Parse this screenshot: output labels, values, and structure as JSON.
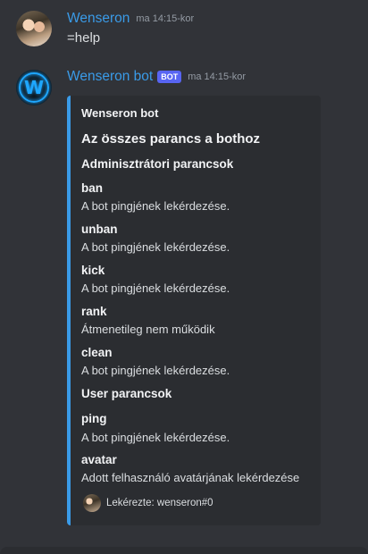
{
  "message1": {
    "username": "Wenseron",
    "timestamp": "ma 14:15-kor",
    "content": "=help"
  },
  "message2": {
    "username": "Wenseron bot",
    "bot_tag": "BOT",
    "timestamp": "ma 14:15-kor",
    "avatar_letter": "W",
    "embed": {
      "author": "Wenseron bot",
      "title": "Az összes parancs a bothoz",
      "sections": [
        {
          "heading": "Adminisztrátori parancsok",
          "fields": [
            {
              "name": "ban",
              "value": "A bot pingjének lekérdezése."
            },
            {
              "name": "unban",
              "value": "A bot pingjének lekérdezése."
            },
            {
              "name": "kick",
              "value": "A bot pingjének lekérdezése."
            },
            {
              "name": "rank",
              "value": "Átmenetileg nem működik"
            },
            {
              "name": "clean",
              "value": "A bot pingjének lekérdezése."
            }
          ]
        },
        {
          "heading": "User parancsok",
          "fields": [
            {
              "name": "ping",
              "value": "A bot pingjének lekérdezése."
            },
            {
              "name": "avatar",
              "value": "Adott felhasználó avatárjának lekérdezése"
            }
          ]
        }
      ],
      "footer": "Lekérezte: wenseron#0"
    }
  },
  "colors": {
    "background": "#313338",
    "embed_background": "#2b2d31",
    "embed_accent": "#3a9be8",
    "username": "#3a9be8",
    "bot_tag": "#5865f2"
  }
}
